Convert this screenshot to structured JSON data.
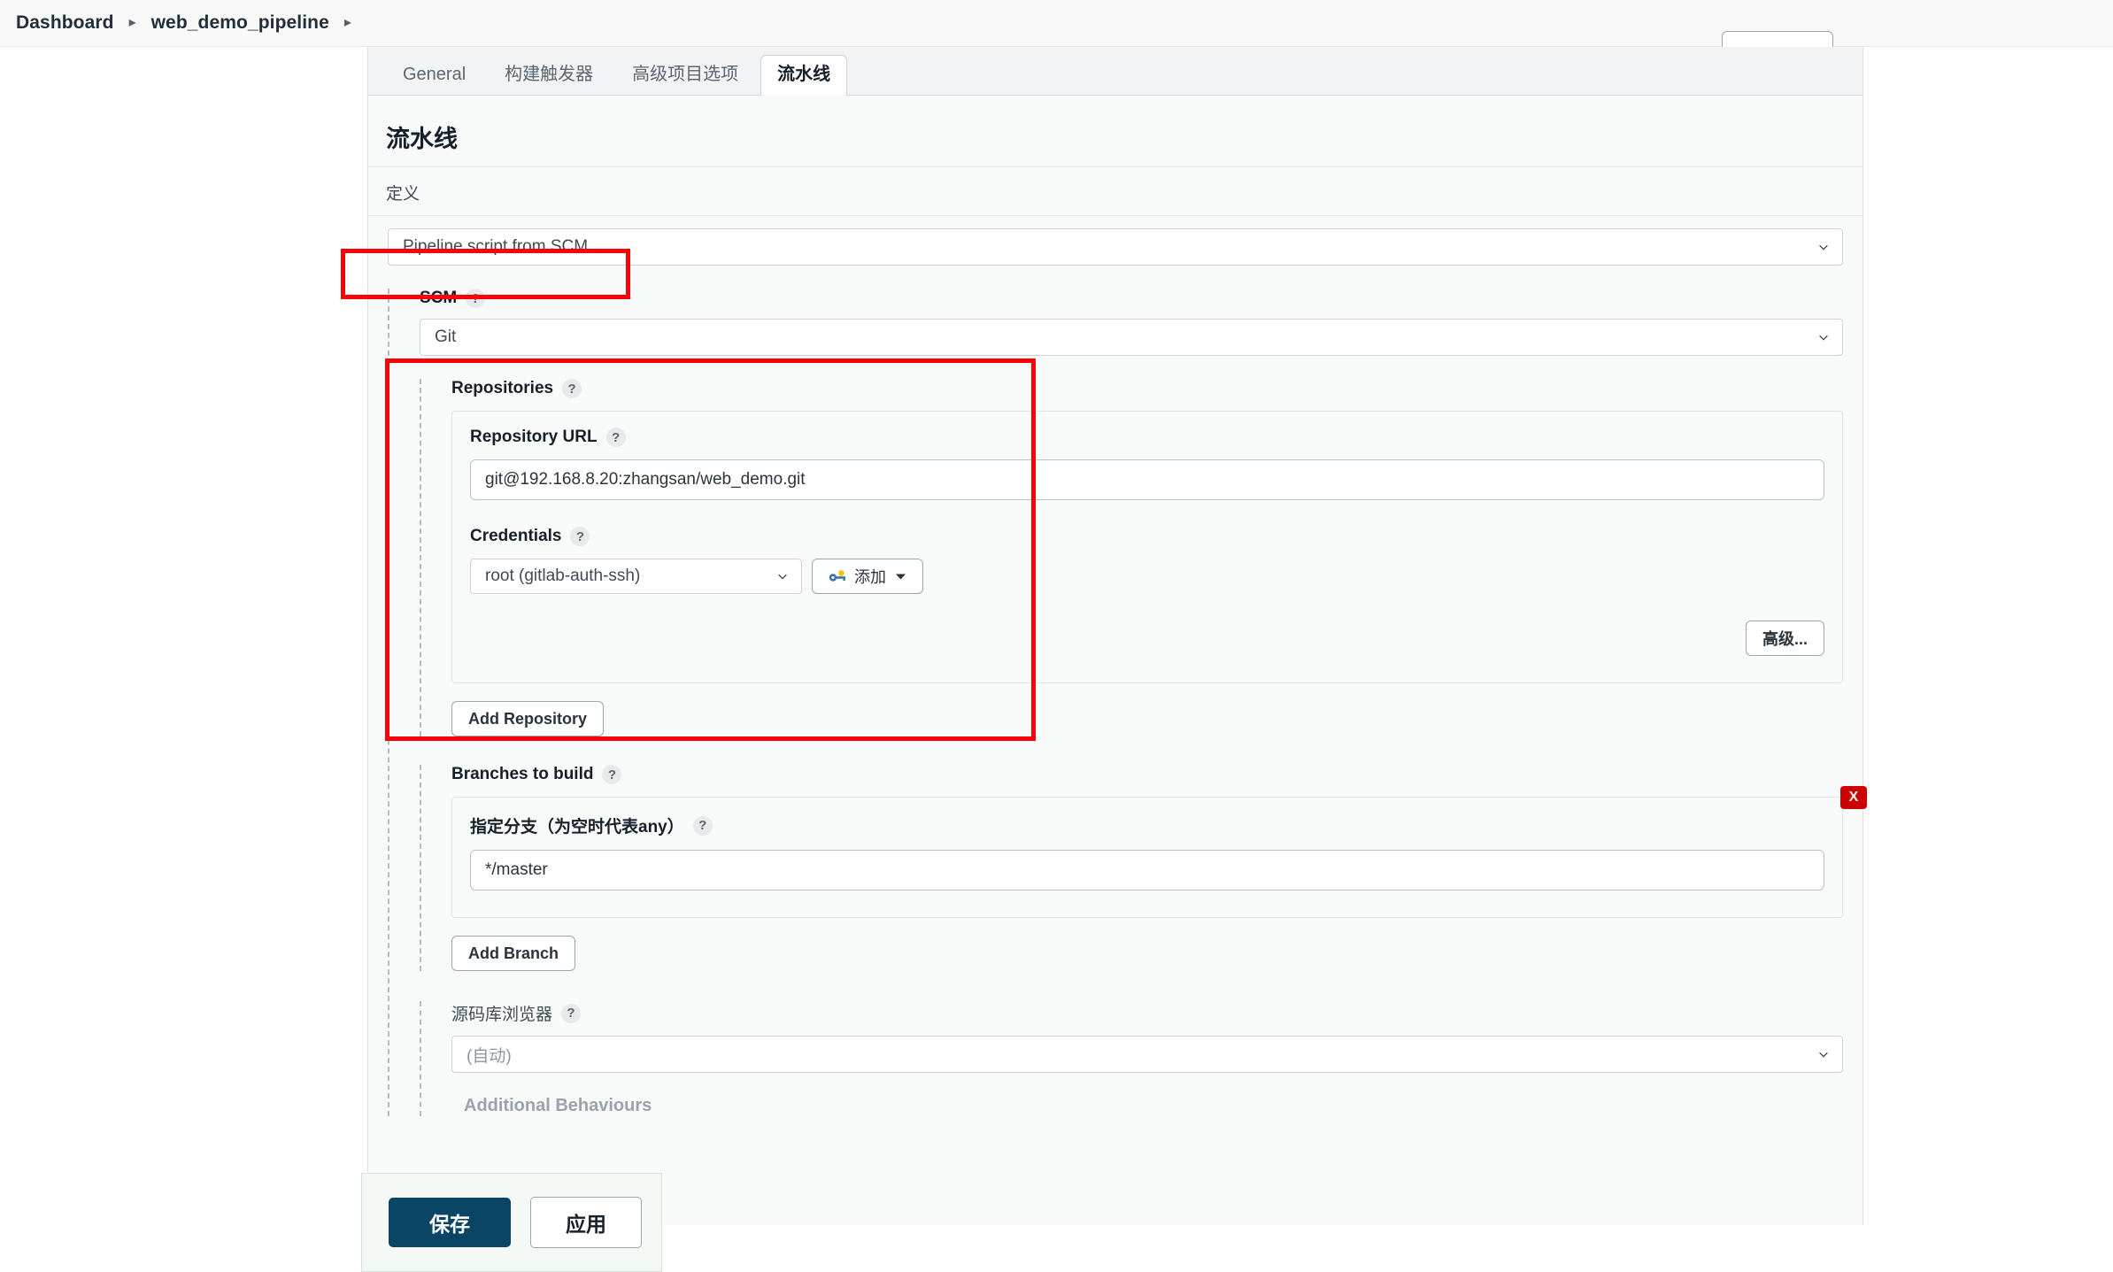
{
  "breadcrumb": {
    "items": [
      {
        "label": "Dashboard"
      },
      {
        "label": "web_demo_pipeline"
      }
    ],
    "separator": "▸"
  },
  "tabs": [
    {
      "label": "General",
      "active": false
    },
    {
      "label": "构建触发器",
      "active": false
    },
    {
      "label": "高级项目选项",
      "active": false
    },
    {
      "label": "流水线",
      "active": true
    }
  ],
  "section": {
    "title": "流水线",
    "definition_label": "定义",
    "definition_value": "Pipeline script from SCM"
  },
  "scm": {
    "label": "SCM",
    "help": "?",
    "value": "Git",
    "repositories": {
      "label": "Repositories",
      "help": "?",
      "url_label": "Repository URL",
      "url_help": "?",
      "url_value": "git@192.168.8.20:zhangsan/web_demo.git",
      "credentials_label": "Credentials",
      "credentials_help": "?",
      "credentials_value": "root (gitlab-auth-ssh)",
      "add_credentials_label": "添加",
      "advanced_label": "高级...",
      "add_repository_label": "Add Repository"
    },
    "branches": {
      "label": "Branches to build",
      "help": "?",
      "branch_label": "指定分支（为空时代表any）",
      "branch_help": "?",
      "branch_value": "*/master",
      "delete_label": "X",
      "add_branch_label": "Add Branch"
    },
    "browser": {
      "label": "源码库浏览器",
      "help": "?",
      "value": "(自动)"
    },
    "additional_behaviours_label": "Additional Behaviours"
  },
  "savebar": {
    "save_label": "保存",
    "apply_label": "应用"
  },
  "colors": {
    "annotation": "#fb0007",
    "save_button": "#0b4566",
    "delete_button": "#cc0000"
  }
}
